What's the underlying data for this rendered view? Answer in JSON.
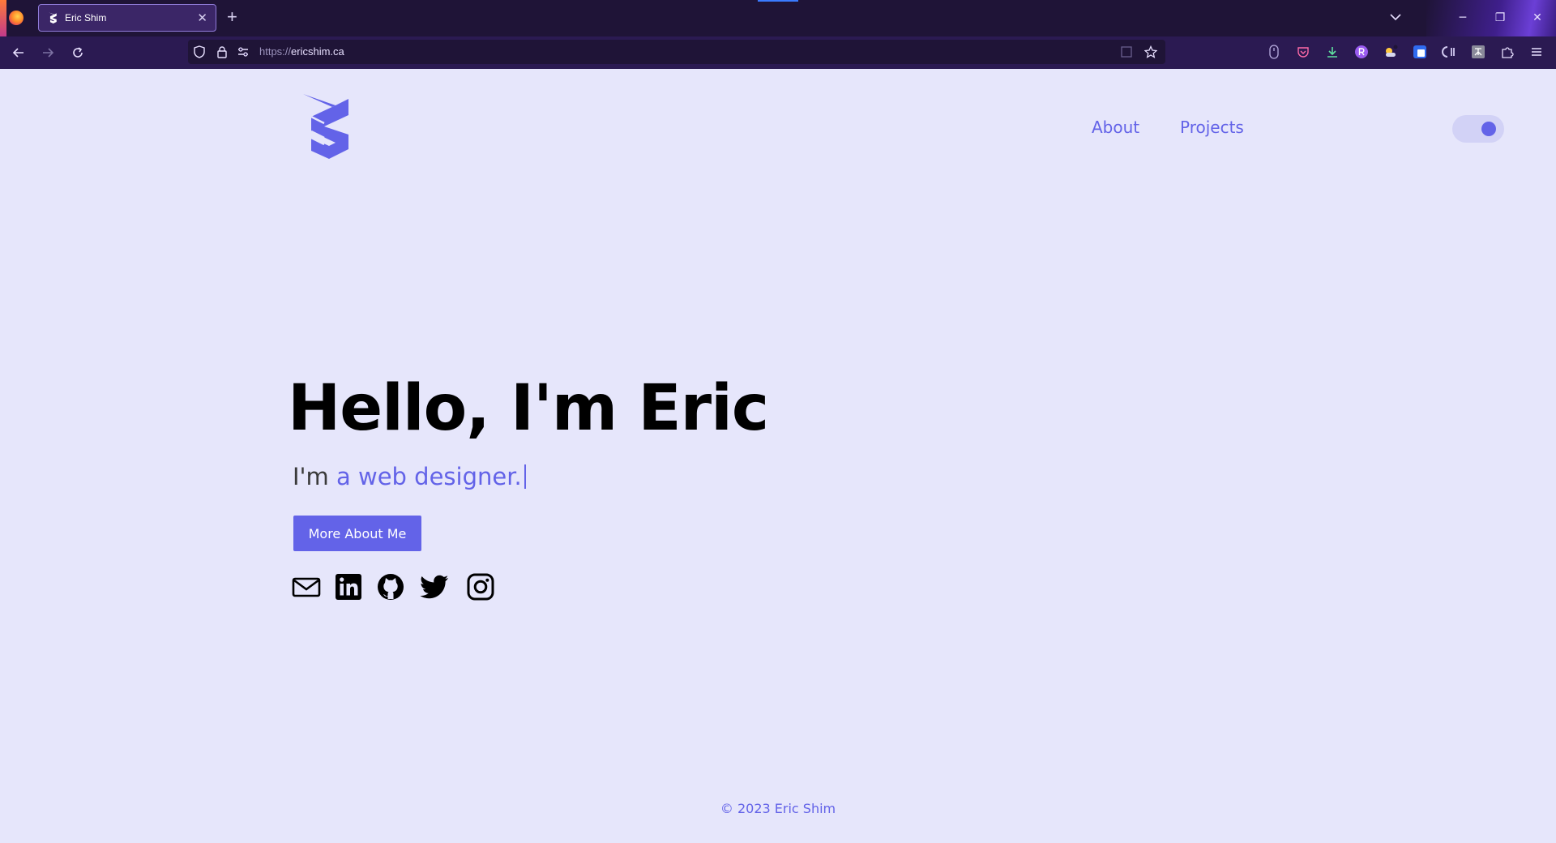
{
  "browser": {
    "tab_title": "Eric Shim",
    "new_tab_label": "+",
    "close_tab_label": "✕",
    "url_scheme": "https://",
    "url_host": "ericshim.ca",
    "window_controls": {
      "minimize": "─",
      "restore": "❐",
      "close": "✕"
    }
  },
  "site": {
    "nav": [
      {
        "label": "About"
      },
      {
        "label": "Projects"
      }
    ],
    "hero": {
      "title": "Hello, I'm Eric",
      "subtitle_prefix": "I'm ",
      "subtitle_typed": "a web designer."
    },
    "cta_label": "More About Me",
    "social_links": [
      "mail-icon",
      "linkedin-icon",
      "github-icon",
      "twitter-icon",
      "instagram-icon"
    ],
    "footer": "© 2023 Eric Shim"
  },
  "colors": {
    "accent": "#6363e8",
    "background": "#e6e6fb",
    "browser_tabbar": "#1f1437",
    "browser_toolbar": "#2b1a52"
  }
}
